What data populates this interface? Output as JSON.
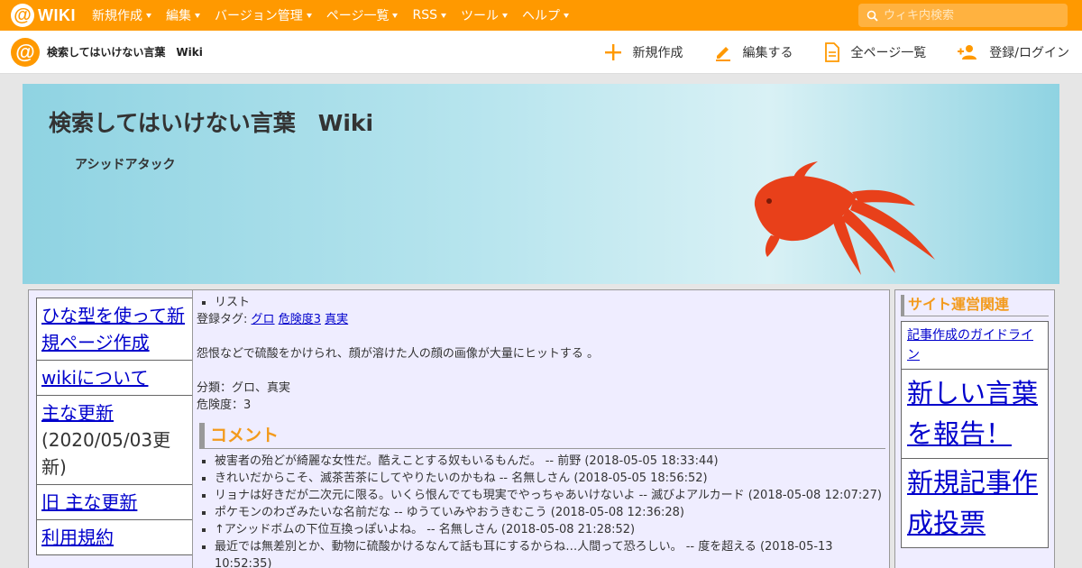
{
  "topbar": {
    "logo_text": "WIKI",
    "menu": [
      "新規作成",
      "編集",
      "バージョン管理",
      "ページ一覧",
      "RSS",
      "ツール",
      "ヘルプ"
    ],
    "search_placeholder": "ウィキ内検索"
  },
  "subbar": {
    "site_title": "検索してはいけない言葉　Wiki",
    "actions": {
      "new": "新規作成",
      "edit": "編集する",
      "all_pages": "全ページ一覧",
      "login": "登録/ログイン"
    }
  },
  "banner": {
    "title": "検索してはいけない言葉　Wiki",
    "subtitle": "アシッドアタック"
  },
  "left_nav": {
    "items": [
      "ひな型を使って新規ページ作成",
      "wikiについて",
      "主な更新",
      "旧 主な更新",
      "利用規約"
    ],
    "update_note": "(2020/05/03更新)"
  },
  "main": {
    "list_item": "リスト",
    "tags_label": "登録タグ:",
    "tags": [
      "グロ",
      "危険度3",
      "真実"
    ],
    "description": "怨恨などで硫酸をかけられ、顔が溶けた人の顔の画像が大量にヒットする 。",
    "category_line": "分類：グロ、真実",
    "danger_line": "危険度：3",
    "comment_heading": "コメント",
    "comments": [
      "被害者の殆どが綺麗な女性だ。酷えことする奴もいるもんだ。 -- 前野 (2018-05-05 18:33:44)",
      "きれいだからこそ、滅茶苦茶にしてやりたいのかもね -- 名無しさん (2018-05-05 18:56:52)",
      "リョナは好きだが二次元に限る。いくら恨んでても現実でやっちゃあいけないよ -- 滅びよアルカード (2018-05-08 12:07:27)",
      "ポケモンのわざみたいな名前だな -- ゆうていみやおうきむこう (2018-05-08 12:36:28)",
      "↑アシッドボムの下位互換っぽいよね。 -- 名無しさん (2018-05-08 21:28:52)",
      "最近では無差別とか、動物に硫酸かけるなんて話も耳にするからね…人間って恐ろしい。 -- 度を超える (2018-05-13 10:52:35)"
    ]
  },
  "right_nav": {
    "heading": "サイト運営関連",
    "guideline": "記事作成のガイドライン",
    "report": "新しい言葉を報告！",
    "vote": "新規記事作成投票"
  },
  "colors": {
    "brand_orange": "#ff9900",
    "heading_orange": "#f39a1c",
    "panel_bg": "#efedff",
    "banner_blue": "#8fd3e2",
    "fish_red": "#e8401a"
  }
}
